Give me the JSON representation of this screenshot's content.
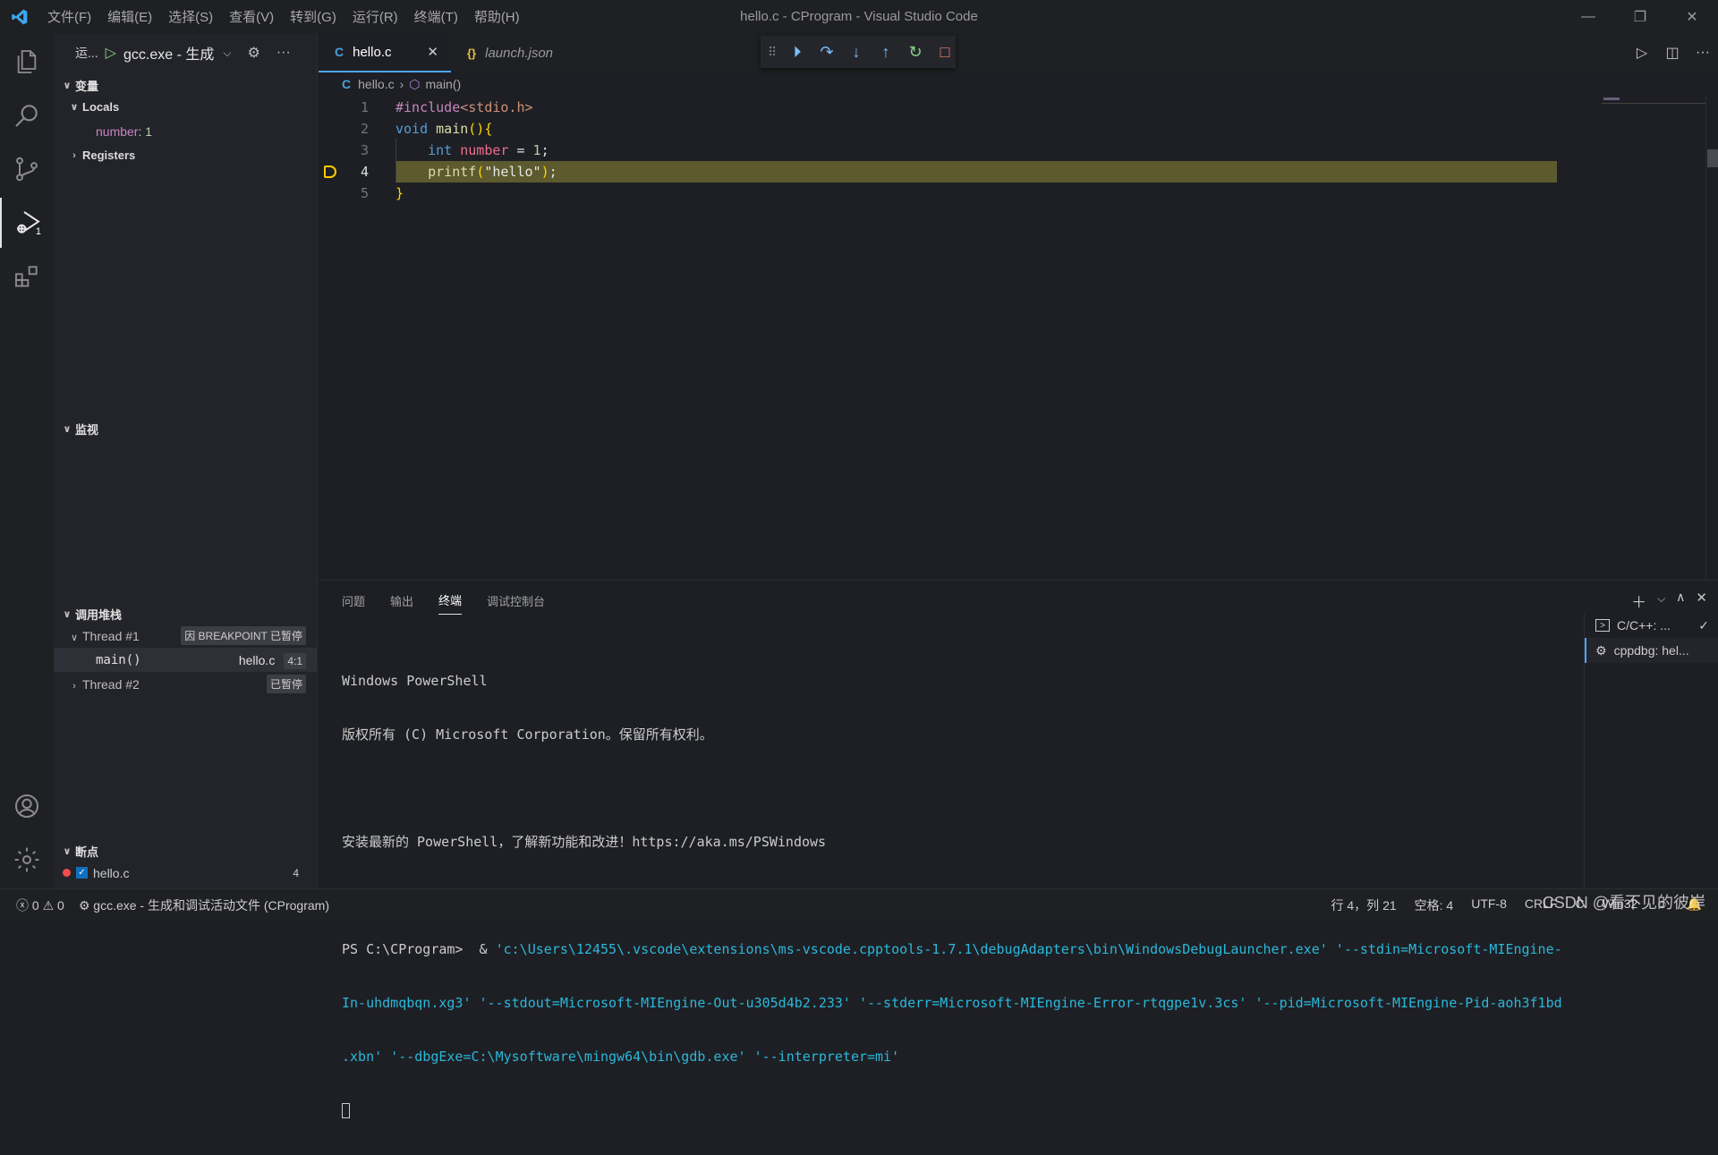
{
  "window": {
    "title": "hello.c - CProgram - Visual Studio Code",
    "menu": [
      "文件(F)",
      "编辑(E)",
      "选择(S)",
      "查看(V)",
      "转到(G)",
      "运行(R)",
      "终端(T)",
      "帮助(H)"
    ]
  },
  "activity": {
    "debug_badge": "1"
  },
  "sidebar": {
    "run_label": "运...",
    "config": "gcc.exe - 生成",
    "variables": {
      "title": "变量",
      "locals_label": "Locals",
      "locals": [
        {
          "name": "number",
          "value": "1"
        }
      ],
      "registers_label": "Registers"
    },
    "watch": {
      "title": "监视"
    },
    "callstack": {
      "title": "调用堆栈",
      "thread1": {
        "label": "Thread #1",
        "status": "因 BREAKPOINT 已暂停"
      },
      "frame": {
        "name": "main()",
        "file": "hello.c",
        "pos": "4:1"
      },
      "thread2": {
        "label": "Thread #2",
        "status": "已暂停"
      }
    },
    "breakpoints": {
      "title": "断点",
      "items": [
        {
          "file": "hello.c",
          "line": "4"
        }
      ]
    }
  },
  "tabs": [
    {
      "label": "hello.c",
      "icon": "C"
    },
    {
      "label": "launch.json",
      "icon": "{}"
    }
  ],
  "breadcrumb": {
    "file": "hello.c",
    "symbol": "main()"
  },
  "code": {
    "line_numbers": [
      "1",
      "2",
      "3",
      "4",
      "5"
    ],
    "current_line": 4
  },
  "panel": {
    "tabs": [
      "问题",
      "输出",
      "终端",
      "调试控制台"
    ],
    "active_tab": "终端",
    "terminal_lines": [
      "Windows PowerShell",
      "版权所有 (C) Microsoft Corporation。保留所有权利。",
      "",
      "安装最新的 PowerShell，了解新功能和改进！https://aka.ms/PSWindows",
      "",
      "PS C:\\CProgram>  & ",
      "'c:\\Users\\12455\\.vscode\\extensions\\ms-vscode.cpptools-1.7.1\\debugAdapters\\bin\\WindowsDebugLauncher.exe' '--stdin=Microsoft-MIEngine-",
      "In-uhdmqbqn.xg3' '--stdout=Microsoft-MIEngine-Out-u305d4b2.233' '--stderr=Microsoft-MIEngine-Error-rtqgpe1v.3cs' '--pid=Microsoft-MIEngine-Pid-aoh3f1bd",
      ".xbn' '--dbgExe=C:\\Mysoftware\\mingw64\\bin\\gdb.exe' '--interpreter=mi'"
    ],
    "terminals": [
      {
        "label": "C/C++: ..."
      },
      {
        "label": "cppdbg: hel..."
      }
    ]
  },
  "status": {
    "errors": "0",
    "warnings": "0",
    "debug_config": "gcc.exe - 生成和调试活动文件 (CProgram)",
    "position": "行 4，列 21",
    "spaces": "空格: 4",
    "encoding": "UTF-8",
    "eol": "CRLF",
    "language": "C",
    "platform": "Win32",
    "watermark": "CSDN @看不见的彼岸"
  },
  "colors": {
    "accent": "#4da3ff",
    "current_line": "#5c5a2e",
    "breakpoint": "#f14c4c"
  }
}
